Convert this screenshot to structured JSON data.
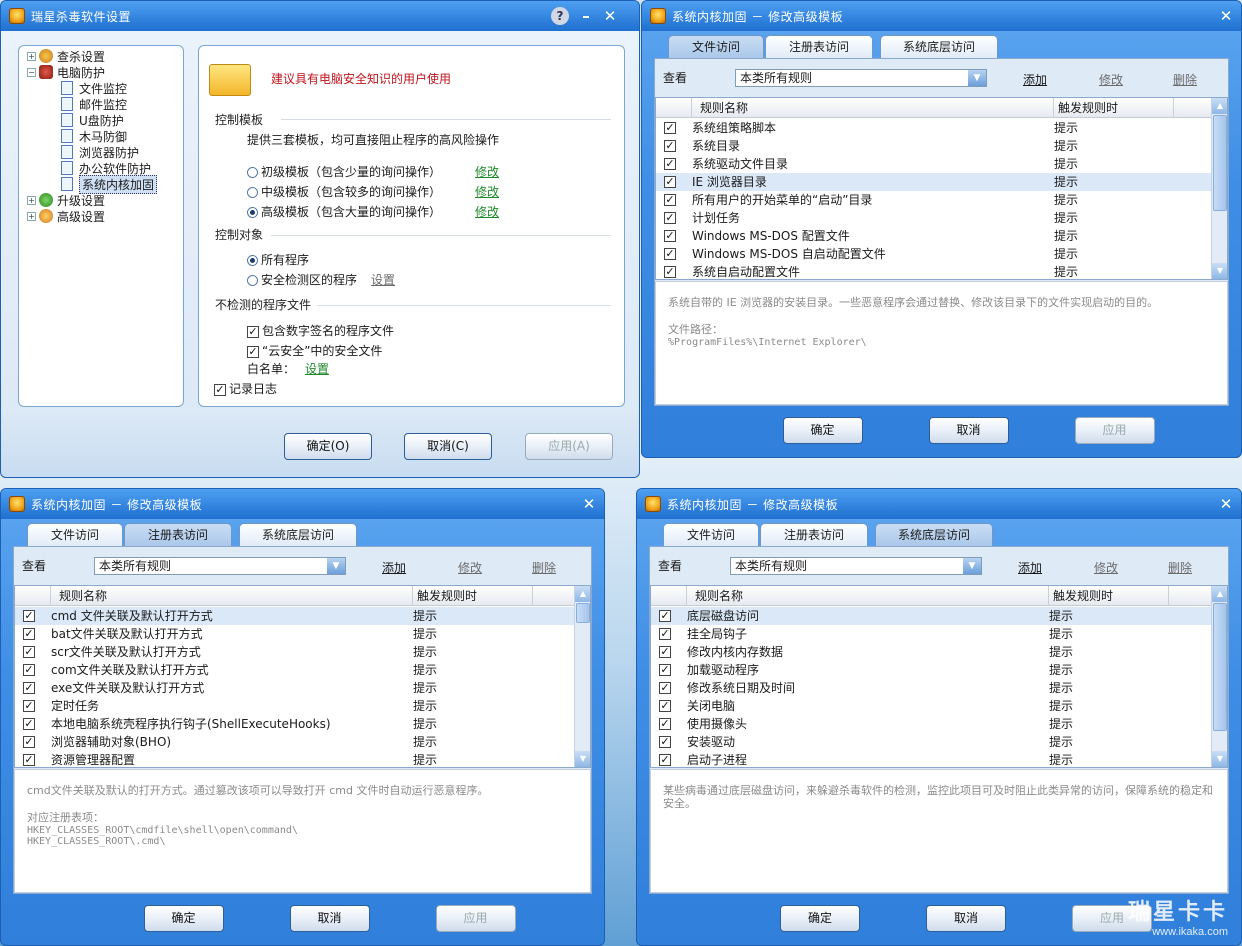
{
  "main_window": {
    "title": "瑞星杀毒软件设置",
    "tree": [
      {
        "label": "查杀设置",
        "expander": "+",
        "level": 0
      },
      {
        "label": "电脑防护",
        "expander": "-",
        "level": 0
      },
      {
        "label": "文件监控",
        "level": 1
      },
      {
        "label": "邮件监控",
        "level": 1
      },
      {
        "label": "U盘防护",
        "level": 1
      },
      {
        "label": "木马防御",
        "level": 1
      },
      {
        "label": "浏览器防护",
        "level": 1
      },
      {
        "label": "办公软件防护",
        "level": 1
      },
      {
        "label": "系统内核加固",
        "level": 1,
        "selected": true
      },
      {
        "label": "升级设置",
        "expander": "+",
        "level": 0
      },
      {
        "label": "高级设置",
        "expander": "+",
        "level": 0
      }
    ],
    "warning": "建议具有电脑安全知识的用户使用",
    "section_template": "控制模板",
    "template_desc": "提供三套模板，均可直接阻止程序的高风险操作",
    "templates": [
      {
        "label": "初级模板（包含少量的询问操作）",
        "link": "修改",
        "checked": false
      },
      {
        "label": "中级模板（包含较多的询问操作）",
        "link": "修改",
        "checked": false
      },
      {
        "label": "高级模板（包含大量的询问操作）",
        "link": "修改",
        "checked": true
      }
    ],
    "section_target": "控制对象",
    "targets": [
      {
        "label": "所有程序",
        "checked": true
      },
      {
        "label": "安全检测区的程序",
        "checked": false,
        "link": "设置"
      }
    ],
    "section_exclude": "不检测的程序文件",
    "exclude_options": [
      {
        "label": "包含数字签名的程序文件",
        "checked": true
      },
      {
        "label": "“云安全”中的安全文件",
        "checked": true
      }
    ],
    "whitelist_label": "白名单：",
    "whitelist_link": "设置",
    "log_label": "记录日志",
    "ok_label": "确定(O)",
    "cancel_label": "取消(C)",
    "apply_label": "应用(A)"
  },
  "dialogs": {
    "file": {
      "title": "系统内核加固 － 修改高级模板",
      "tabs": [
        "文件访问",
        "注册表访问",
        "系统底层访问"
      ],
      "active_tab": 0,
      "view_label": "查看",
      "filter": "本类所有规则",
      "add": "添加",
      "modify": "修改",
      "delete": "删除",
      "col_name": "规则名称",
      "col_trigger": "触发规则时",
      "rows": [
        {
          "name": "系统组策略脚本",
          "action": "提示"
        },
        {
          "name": "系统目录",
          "action": "提示"
        },
        {
          "name": "系统驱动文件目录",
          "action": "提示"
        },
        {
          "name": "IE 浏览器目录",
          "action": "提示",
          "hl": true
        },
        {
          "name": "所有用户的开始菜单的“启动”目录",
          "action": "提示"
        },
        {
          "name": "计划任务",
          "action": "提示"
        },
        {
          "name": "Windows MS-DOS 配置文件",
          "action": "提示"
        },
        {
          "name": "Windows MS-DOS 自启动配置文件",
          "action": "提示"
        },
        {
          "name": "系统自启动配置文件",
          "action": "提示"
        }
      ],
      "desc": "系统自带的 IE 浏览器的安装目录。一些恶意程序会通过替换、修改该目录下的文件实现启动的目的。",
      "path_label": "文件路径：",
      "paths": [
        "%ProgramFiles%\\Internet Explorer\\"
      ],
      "ok": "确定",
      "cancel": "取消",
      "apply": "应用"
    },
    "reg": {
      "title": "系统内核加固 － 修改高级模板",
      "tabs": [
        "文件访问",
        "注册表访问",
        "系统底层访问"
      ],
      "active_tab": 1,
      "view_label": "查看",
      "filter": "本类所有规则",
      "add": "添加",
      "modify": "修改",
      "delete": "删除",
      "col_name": "规则名称",
      "col_trigger": "触发规则时",
      "rows": [
        {
          "name": "cmd 文件关联及默认打开方式",
          "action": "提示",
          "hl": true
        },
        {
          "name": "bat文件关联及默认打开方式",
          "action": "提示"
        },
        {
          "name": "scr文件关联及默认打开方式",
          "action": "提示"
        },
        {
          "name": "com文件关联及默认打开方式",
          "action": "提示"
        },
        {
          "name": "exe文件关联及默认打开方式",
          "action": "提示"
        },
        {
          "name": "定时任务",
          "action": "提示"
        },
        {
          "name": "本地电脑系统壳程序执行钩子(ShellExecuteHooks)",
          "action": "提示"
        },
        {
          "name": "浏览器辅助对象(BHO)",
          "action": "提示"
        },
        {
          "name": "资源管理器配置",
          "action": "提示"
        }
      ],
      "desc": "cmd文件关联及默认的打开方式。通过篡改该项可以导致打开 cmd 文件时自动运行恶意程序。",
      "path_label": "对应注册表项：",
      "paths": [
        "HKEY_CLASSES_ROOT\\cmdfile\\shell\\open\\command\\",
        "HKEY_CLASSES_ROOT\\.cmd\\"
      ],
      "ok": "确定",
      "cancel": "取消",
      "apply": "应用"
    },
    "low": {
      "title": "系统内核加固 － 修改高级模板",
      "tabs": [
        "文件访问",
        "注册表访问",
        "系统底层访问"
      ],
      "active_tab": 2,
      "view_label": "查看",
      "filter": "本类所有规则",
      "add": "添加",
      "modify": "修改",
      "delete": "删除",
      "col_name": "规则名称",
      "col_trigger": "触发规则时",
      "rows": [
        {
          "name": "底层磁盘访问",
          "action": "提示",
          "hl": true
        },
        {
          "name": "挂全局钩子",
          "action": "提示"
        },
        {
          "name": "修改内核内存数据",
          "action": "提示"
        },
        {
          "name": "加载驱动程序",
          "action": "提示"
        },
        {
          "name": "修改系统日期及时间",
          "action": "提示"
        },
        {
          "name": "关闭电脑",
          "action": "提示"
        },
        {
          "name": "使用摄像头",
          "action": "提示"
        },
        {
          "name": "安装驱动",
          "action": "提示"
        },
        {
          "name": "启动子进程",
          "action": "提示"
        }
      ],
      "desc": "某些病毒通过底层磁盘访问，来躲避杀毒软件的检测，监控此项目可及时阻止此类异常的访问，保障系统的稳定和安全。",
      "path_label": "",
      "paths": [],
      "ok": "确定",
      "cancel": "取消",
      "apply": "应用"
    }
  },
  "watermark": {
    "brand": "瑞星卡卡",
    "url": "www.ikaka.com"
  }
}
